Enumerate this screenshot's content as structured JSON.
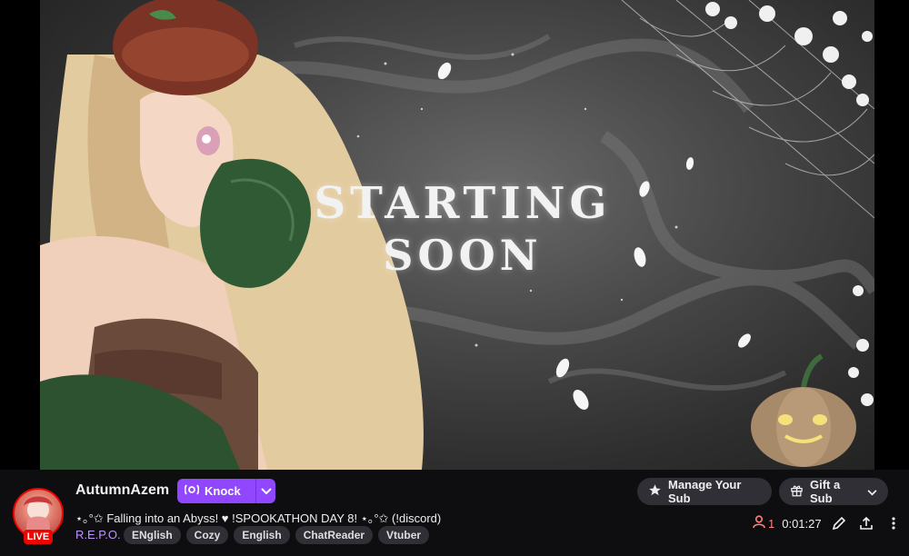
{
  "overlay": {
    "line1": "STARTING",
    "line2": "SOON"
  },
  "channel": {
    "name": "AutumnAzem",
    "live_label": "LIVE",
    "title": "⋆｡°✩ Falling into an Abyss! ♥ !SPOOKATHON DAY 8! ⋆｡°✩ (!discord)",
    "category": "R.E.P.O.",
    "tags": [
      "ENglish",
      "Cozy",
      "English",
      "ChatReader",
      "Vtuber"
    ]
  },
  "buttons": {
    "knock": "Knock",
    "manage_sub": "Manage Your Sub",
    "gift_sub": "Gift a Sub"
  },
  "stats": {
    "viewers": "1",
    "uptime": "0:01:27"
  },
  "colors": {
    "accent": "#9147ff",
    "live": "#eb0400",
    "viewer": "#ff8280",
    "category": "#bf94ff"
  },
  "icons": [
    "knock-icon",
    "chevron-down-icon",
    "star-icon",
    "gift-icon",
    "person-icon",
    "pencil-icon",
    "share-icon",
    "more-vertical-icon"
  ]
}
